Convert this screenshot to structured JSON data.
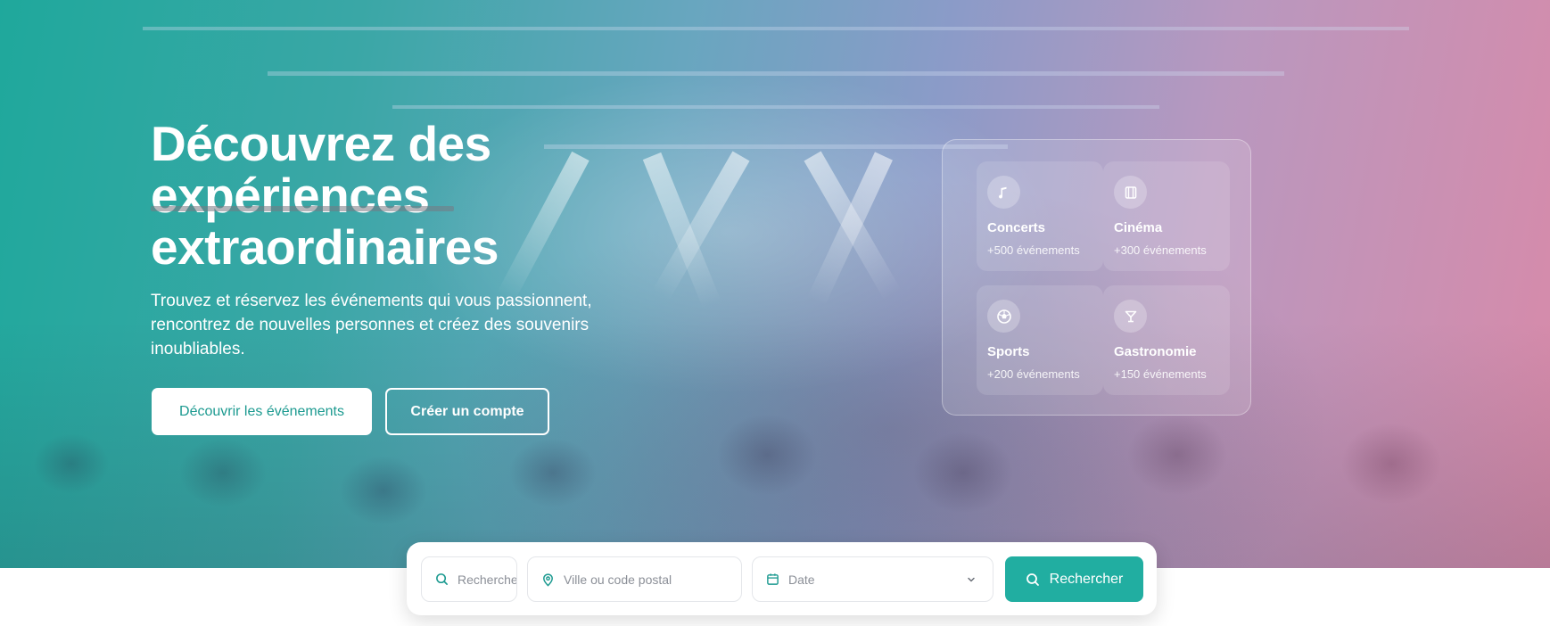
{
  "hero": {
    "headline_line1": "Découvrez des",
    "headline_line2": "expériences",
    "headline_line3": "extraordinaires",
    "subtitle": "Trouvez et réservez les événements qui vous passionnent, rencontrez de nouvelles personnes et créez des souvenirs inoubliables.",
    "primary_button": "Découvrir les événements",
    "secondary_button": "Créer un compte"
  },
  "categories": [
    {
      "name": "Concerts",
      "count": "+500 événements",
      "icon": "music-note-icon"
    },
    {
      "name": "Cinéma",
      "count": "+300 événements",
      "icon": "film-icon"
    },
    {
      "name": "Sports",
      "count": "+200 événements",
      "icon": "ball-icon"
    },
    {
      "name": "Gastronomie",
      "count": "+150 événements",
      "icon": "cocktail-glass-icon"
    }
  ],
  "search": {
    "keyword_placeholder": "Rechercher",
    "location_placeholder": "Ville ou code postal",
    "date_label": "Date",
    "button_label": "Rechercher"
  },
  "colors": {
    "accent": "#21aea1",
    "primary_button_text": "#1c9a90",
    "hero_gradient_start": "#1fa89c",
    "hero_gradient_end": "#d88aa9"
  }
}
